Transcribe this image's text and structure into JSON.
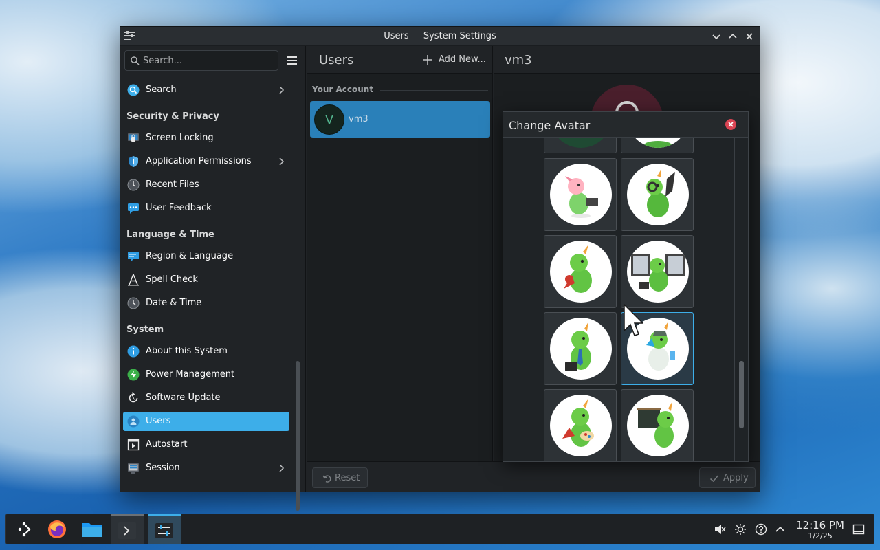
{
  "window": {
    "title": "Users — System Settings"
  },
  "sidebar": {
    "search_placeholder": "Search...",
    "items": {
      "search": "Search",
      "security_section": "Security & Privacy",
      "screen_locking": "Screen Locking",
      "app_permissions": "Application Permissions",
      "recent_files": "Recent Files",
      "user_feedback": "User Feedback",
      "language_section": "Language & Time",
      "region_language": "Region & Language",
      "spell_check": "Spell Check",
      "date_time": "Date & Time",
      "system_section": "System",
      "about": "About this System",
      "power": "Power Management",
      "software_update": "Software Update",
      "users": "Users",
      "autostart": "Autostart",
      "session": "Session"
    },
    "active": "Users"
  },
  "users_panel": {
    "title": "Users",
    "add_new": "Add New...",
    "section": "Your Account",
    "user": {
      "initial": "V",
      "name": "vm3"
    }
  },
  "detail_panel": {
    "title": "vm3"
  },
  "dialog": {
    "title": "Change Avatar",
    "selected_tile": 6,
    "tile_count": 10
  },
  "footer": {
    "reset": "Reset",
    "apply": "Apply"
  },
  "taskbar": {
    "apps": [
      "app-launcher",
      "firefox",
      "file-manager",
      "terminal",
      "system-settings"
    ],
    "time": "12:16 PM",
    "date": "1/2/25"
  },
  "colors": {
    "accent": "#3daee9",
    "window_bg": "#202326",
    "dialog_close": "#da4453"
  }
}
